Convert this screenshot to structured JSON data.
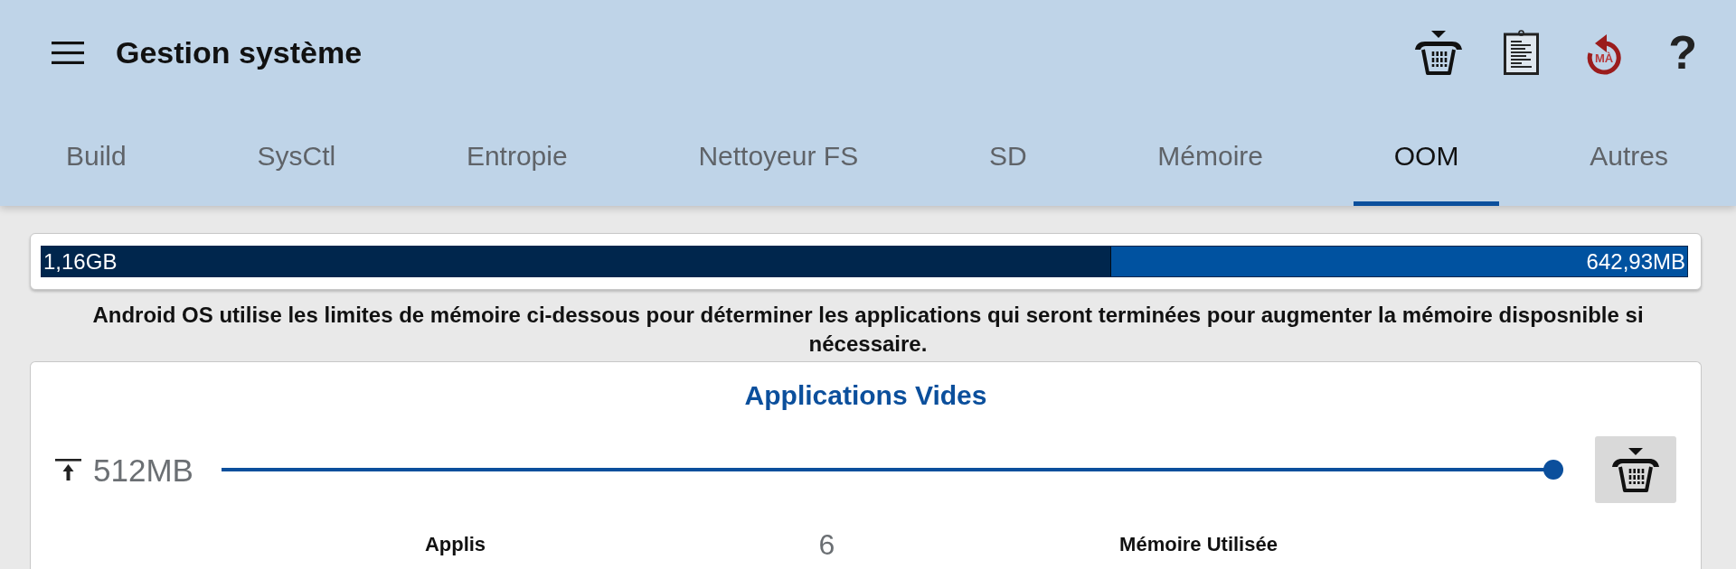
{
  "app_bar": {
    "title": "Gestion système",
    "update_label": "MÀ",
    "help": "?"
  },
  "tabs": [
    {
      "label": "Build",
      "selected": false
    },
    {
      "label": "SysCtl",
      "selected": false
    },
    {
      "label": "Entropie",
      "selected": false
    },
    {
      "label": "Nettoyeur FS",
      "selected": false
    },
    {
      "label": "SD",
      "selected": false
    },
    {
      "label": "Mémoire",
      "selected": false
    },
    {
      "label": "OOM",
      "selected": true
    },
    {
      "label": "Autres",
      "selected": false
    }
  ],
  "memory_bar": {
    "used": "1,16GB",
    "free": "642,93MB",
    "level": 0.65
  },
  "description": "Android OS utilise les limites de mémoire ci-dessous pour déterminer les applications qui seront terminées pour augmenter la mémoire disposnible si nécessaire.",
  "panel": {
    "title": "Applications Vides",
    "slider": {
      "reading": "512MB",
      "level": 1
    },
    "stats": [
      {
        "label": "Applis",
        "value": "6"
      },
      {
        "label": "Mémoire Utilisée"
      }
    ]
  }
}
